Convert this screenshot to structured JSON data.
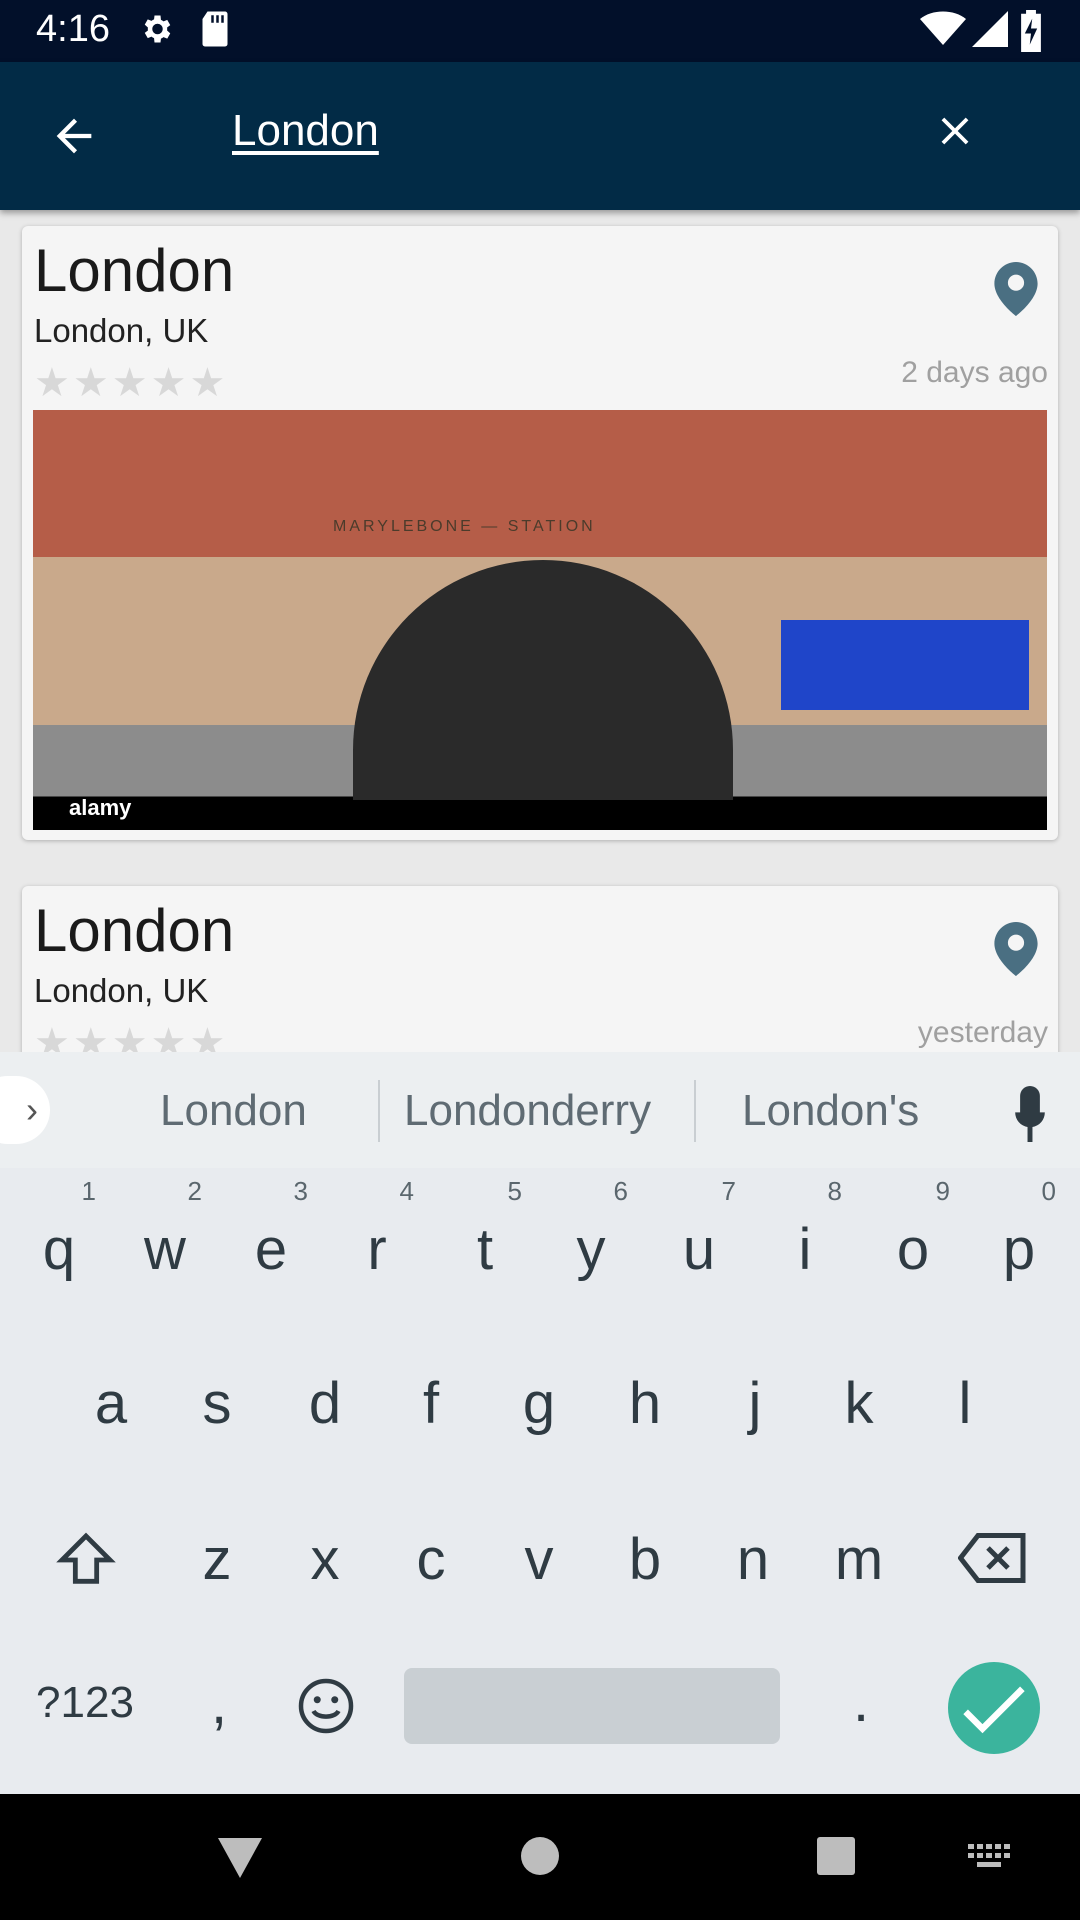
{
  "status_bar": {
    "time": "4:16",
    "icons": [
      "settings-icon",
      "sd-card-icon",
      "wifi-icon",
      "signal-icon",
      "battery-charging-icon"
    ]
  },
  "search": {
    "query": "London",
    "back_icon": "arrow-left-icon",
    "clear_icon": "close-icon"
  },
  "results": [
    {
      "title": "London",
      "subtitle": "London, UK",
      "stars": "★★★★★",
      "date": "2 days ago",
      "photo": {
        "sign": "MARYLEBONE — STATION",
        "watermark": "alamy"
      }
    },
    {
      "title": "London",
      "subtitle": "London, UK",
      "stars": "★★★★★",
      "date": "yesterday"
    }
  ],
  "keyboard": {
    "suggestions": [
      "London",
      "Londonderry",
      "London's"
    ],
    "row1": [
      {
        "k": "q",
        "n": "1"
      },
      {
        "k": "w",
        "n": "2"
      },
      {
        "k": "e",
        "n": "3"
      },
      {
        "k": "r",
        "n": "4"
      },
      {
        "k": "t",
        "n": "5"
      },
      {
        "k": "y",
        "n": "6"
      },
      {
        "k": "u",
        "n": "7"
      },
      {
        "k": "i",
        "n": "8"
      },
      {
        "k": "o",
        "n": "9"
      },
      {
        "k": "p",
        "n": "0"
      }
    ],
    "row2": [
      "a",
      "s",
      "d",
      "f",
      "g",
      "h",
      "j",
      "k",
      "l"
    ],
    "row3": [
      "z",
      "x",
      "c",
      "v",
      "b",
      "n",
      "m"
    ],
    "symbols_label": "?123",
    "comma": ",",
    "period": "."
  },
  "colors": {
    "status_bar": "#02102a",
    "search_bar": "#022b46",
    "pin": "#4a6f82",
    "enter_key": "#3bb49d"
  }
}
